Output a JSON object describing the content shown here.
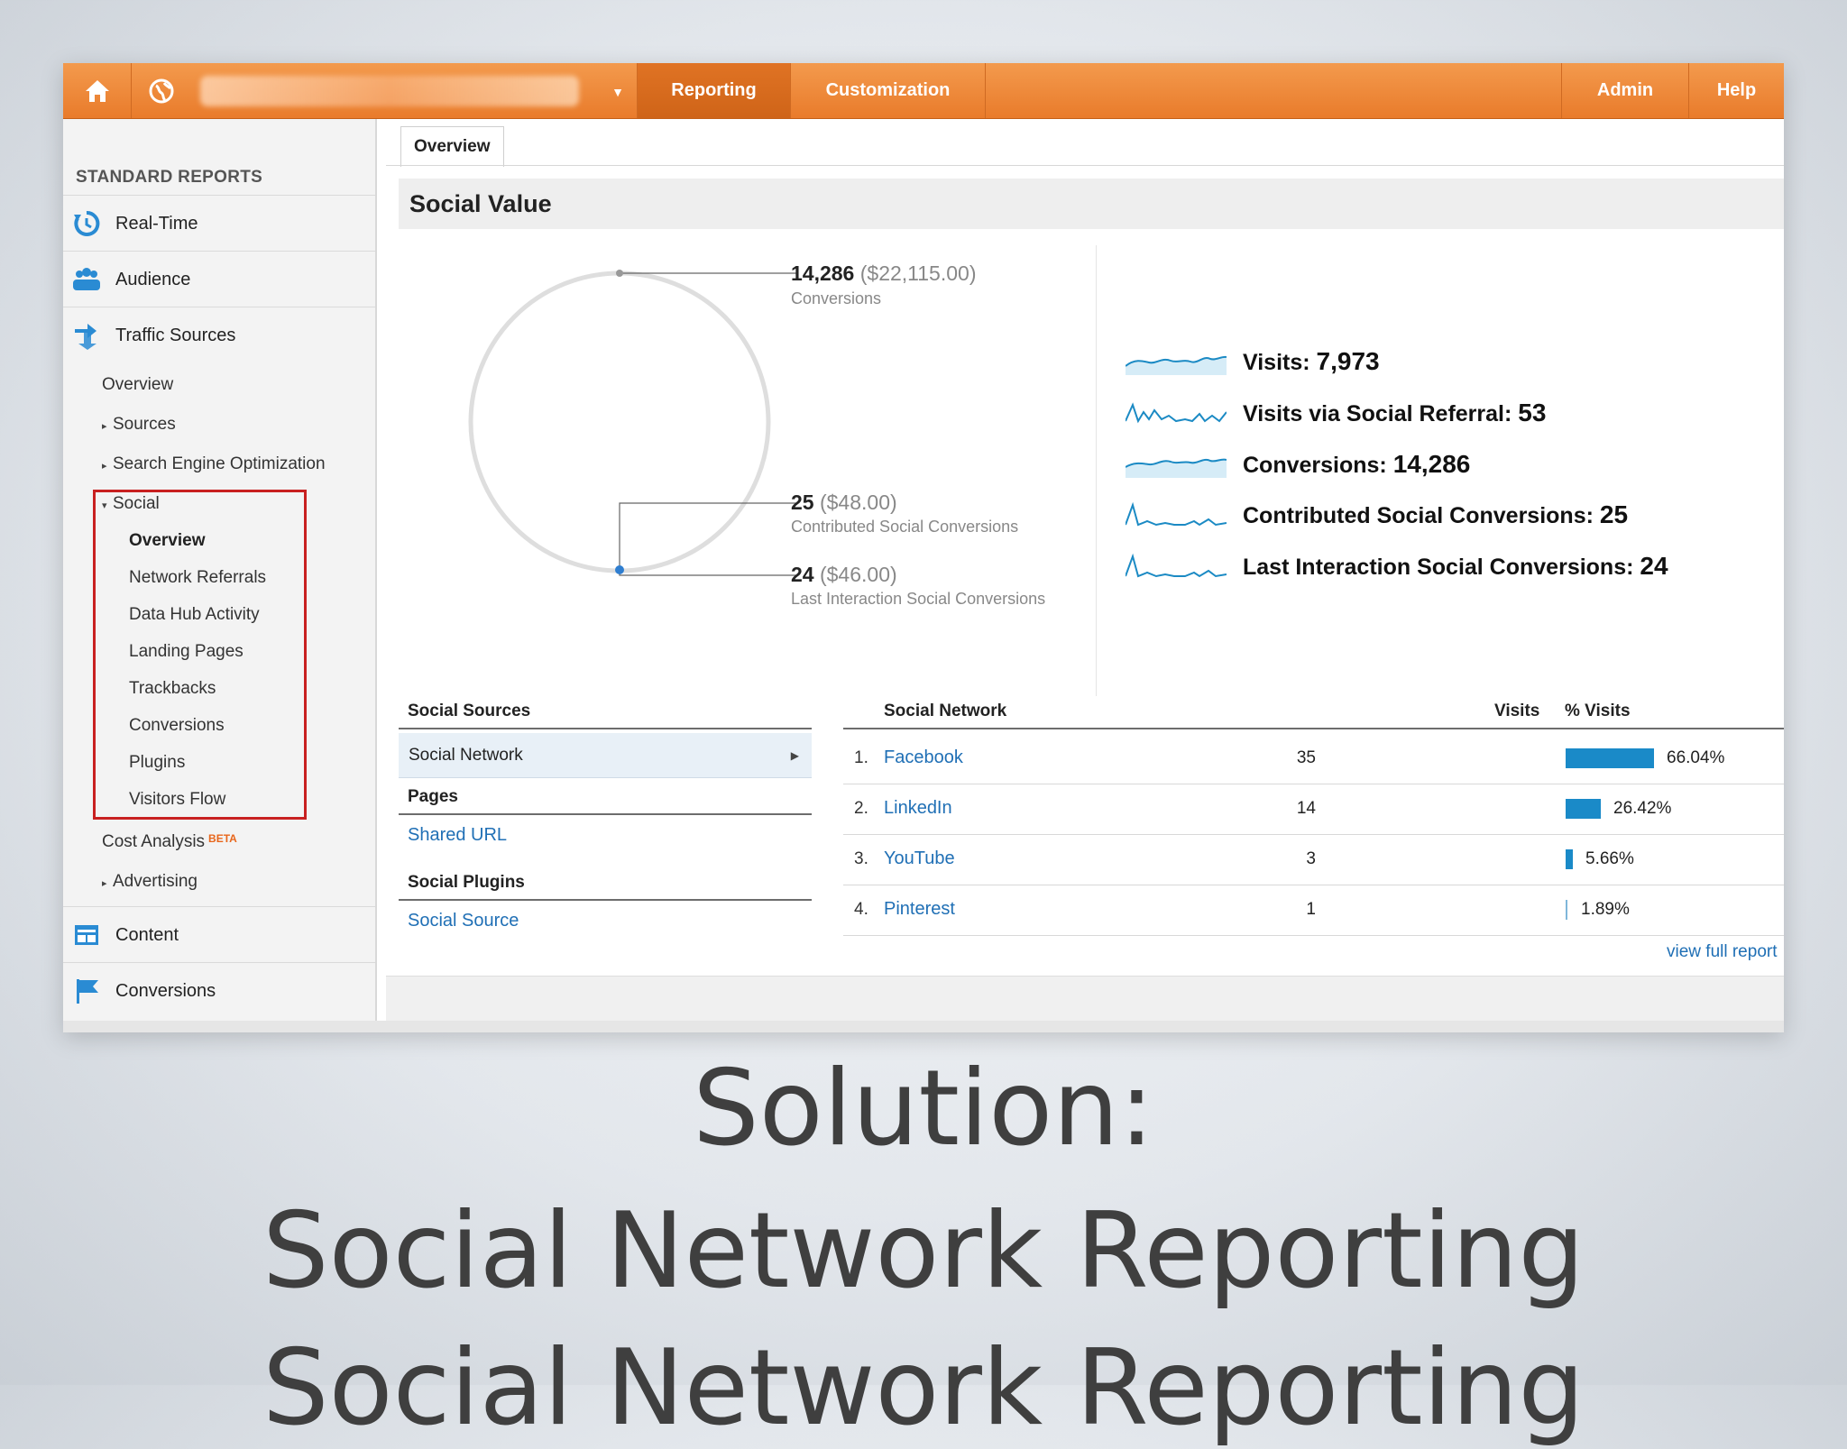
{
  "topbar": {
    "reporting": "Reporting",
    "customization": "Customization",
    "admin": "Admin",
    "help": "Help"
  },
  "sidebar": {
    "heading": "STANDARD REPORTS",
    "realtime": "Real-Time",
    "audience": "Audience",
    "traffic_sources": "Traffic Sources",
    "ts_overview": "Overview",
    "sources": "Sources",
    "seo": "Search Engine Optimization",
    "social": "Social",
    "social_items": [
      "Overview",
      "Network Referrals",
      "Data Hub Activity",
      "Landing Pages",
      "Trackbacks",
      "Conversions",
      "Plugins",
      "Visitors Flow"
    ],
    "cost_analysis": "Cost Analysis",
    "beta": "BETA",
    "advertising": "Advertising",
    "content": "Content",
    "conversions": "Conversions"
  },
  "main": {
    "tab": "Overview",
    "section_title": "Social Value",
    "callouts": [
      {
        "value": "14,286",
        "money": "($22,115.00)",
        "label": "Conversions"
      },
      {
        "value": "25",
        "money": "($48.00)",
        "label": "Contributed Social Conversions"
      },
      {
        "value": "24",
        "money": "($46.00)",
        "label": "Last Interaction Social Conversions"
      }
    ],
    "metrics": [
      {
        "label": "Visits:",
        "value": "7,973"
      },
      {
        "label": "Visits via Social Referral:",
        "value": "53"
      },
      {
        "label": "Conversions:",
        "value": "14,286"
      },
      {
        "label": "Contributed Social Conversions:",
        "value": "25"
      },
      {
        "label": "Last Interaction Social Conversions:",
        "value": "24"
      }
    ]
  },
  "lists": {
    "social_sources": "Social Sources",
    "social_network": "Social Network",
    "pages": "Pages",
    "shared_url": "Shared URL",
    "social_plugins": "Social Plugins",
    "social_source": "Social Source"
  },
  "table": {
    "col_network": "Social Network",
    "col_visits": "Visits",
    "col_pct": "% Visits",
    "rows": [
      {
        "idx": "1.",
        "name": "Facebook",
        "visits": "35",
        "pct": "66.04%",
        "share": 0.6604
      },
      {
        "idx": "2.",
        "name": "LinkedIn",
        "visits": "14",
        "pct": "26.42%",
        "share": 0.2642
      },
      {
        "idx": "3.",
        "name": "YouTube",
        "visits": "3",
        "pct": "5.66%",
        "share": 0.0566
      },
      {
        "idx": "4.",
        "name": "Pinterest",
        "visits": "1",
        "pct": "1.89%",
        "share": 0.0189
      }
    ],
    "view_full_report": "view full report"
  },
  "slide": {
    "line1": "Solution:",
    "line2": "Social Network Reporting",
    "line3": "Social Network Reporting"
  },
  "colors": {
    "accent_orange": "#e97b2b",
    "link_blue": "#1f6fb5",
    "bar_blue": "#1a8ac8",
    "highlight_red": "#c82020"
  }
}
